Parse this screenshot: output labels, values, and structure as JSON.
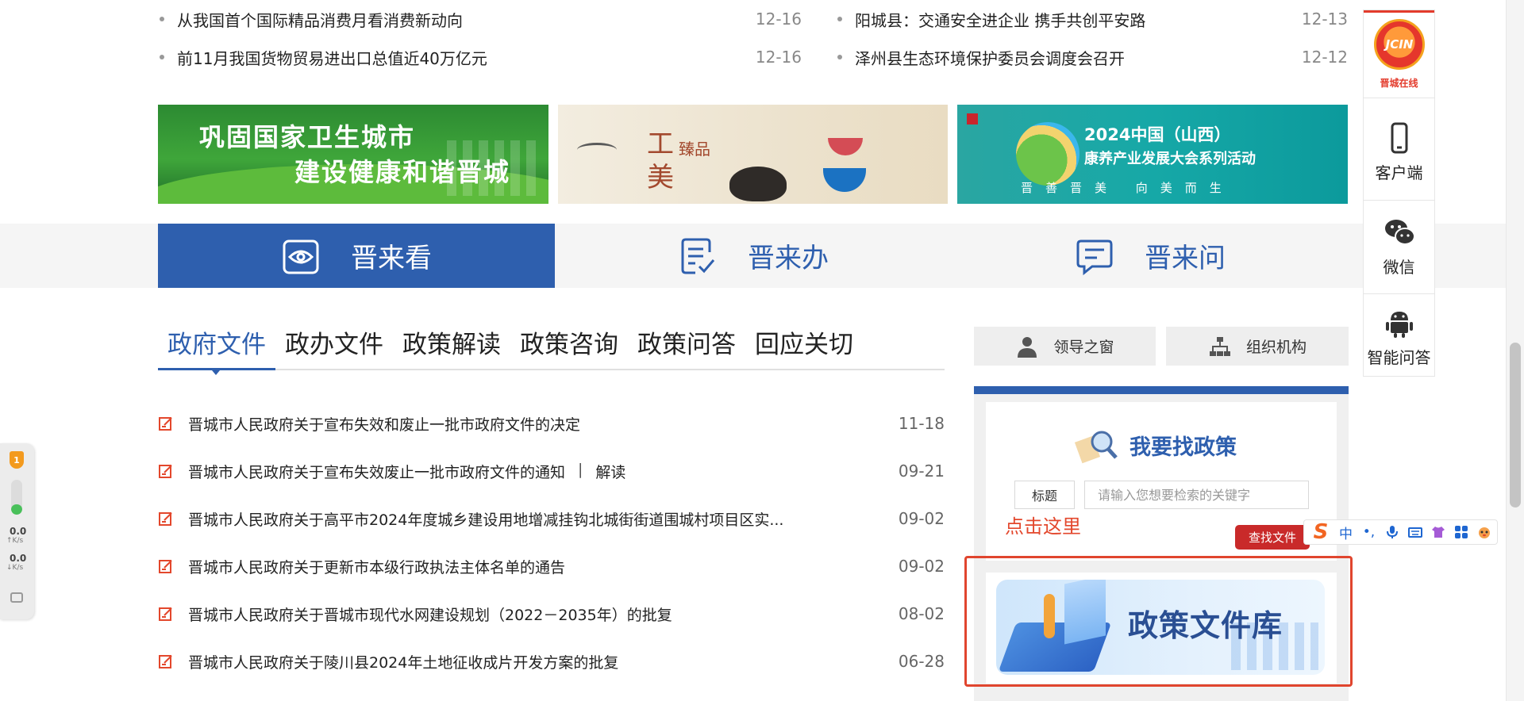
{
  "news": {
    "left": [
      {
        "title": "从我国首个国际精品消费月看消费新动向",
        "date": "12-16"
      },
      {
        "title": "前11月我国货物贸易进出口总值近40万亿元",
        "date": "12-16"
      }
    ],
    "right": [
      {
        "title": "阳城县：交通安全进企业 携手共创平安路",
        "date": "12-13"
      },
      {
        "title": "泽州县生态环境保护委员会调度会召开",
        "date": "12-12"
      }
    ]
  },
  "banners": {
    "b1": {
      "line1": "巩固国家卫生城市",
      "line2": "建设健康和谐晋城"
    },
    "b2": {
      "char1": "工",
      "char2": "美",
      "char3": "臻品"
    },
    "b3": {
      "line1": "2024中国（山西）",
      "line2": "康养产业发展大会系列活动",
      "line3": "晋善晋美 向美而生"
    }
  },
  "services": {
    "look": "晋来看",
    "handle": "晋来办",
    "ask": "晋来问"
  },
  "tabs": [
    "政府文件",
    "政办文件",
    "政策解读",
    "政策咨询",
    "政策问答",
    "回应关切"
  ],
  "docs": [
    {
      "title": "晋城市人民政府关于宣布失效和废止一批市政府文件的决定",
      "date": "11-18"
    },
    {
      "title": "晋城市人民政府关于宣布失效废止一批市政府文件的通知",
      "sep": "|",
      "extra": "解读",
      "date": "09-21"
    },
    {
      "title": "晋城市人民政府关于高平市2024年度城乡建设用地增减挂钩北城街街道围城村项目区实...",
      "date": "09-02"
    },
    {
      "title": "晋城市人民政府关于更新市本级行政执法主体名单的通告",
      "date": "09-02"
    },
    {
      "title": "晋城市人民政府关于晋城市现代水网建设规划（2022－2035年）的批复",
      "date": "08-02"
    },
    {
      "title": "晋城市人民政府关于陵川县2024年土地征收成片开发方案的批复",
      "date": "06-28"
    }
  ],
  "right_panel": {
    "leaders": "领导之窗",
    "org": "组织机构",
    "finder_title": "我要找政策",
    "search_label": "标题",
    "search_placeholder": "请输入您想要检索的关键字",
    "click_hint": "点击这里",
    "library": "政策文件库"
  },
  "sidebar": {
    "logo_mark": "JCIN",
    "logo_text": "晋城在线",
    "client": "客户端",
    "wechat": "微信",
    "smart_qa": "智能问答"
  },
  "net_widget": {
    "badge": "1",
    "up_value": "0.0",
    "up_unit": "K/s",
    "down_value": "0.0",
    "down_unit": "K/s"
  },
  "ime": {
    "tag": "查找文件",
    "logo": "S",
    "lang": "中",
    "punct": "•,"
  },
  "colors": {
    "brand_blue": "#2e5fae",
    "accent_red": "#e0452e"
  }
}
